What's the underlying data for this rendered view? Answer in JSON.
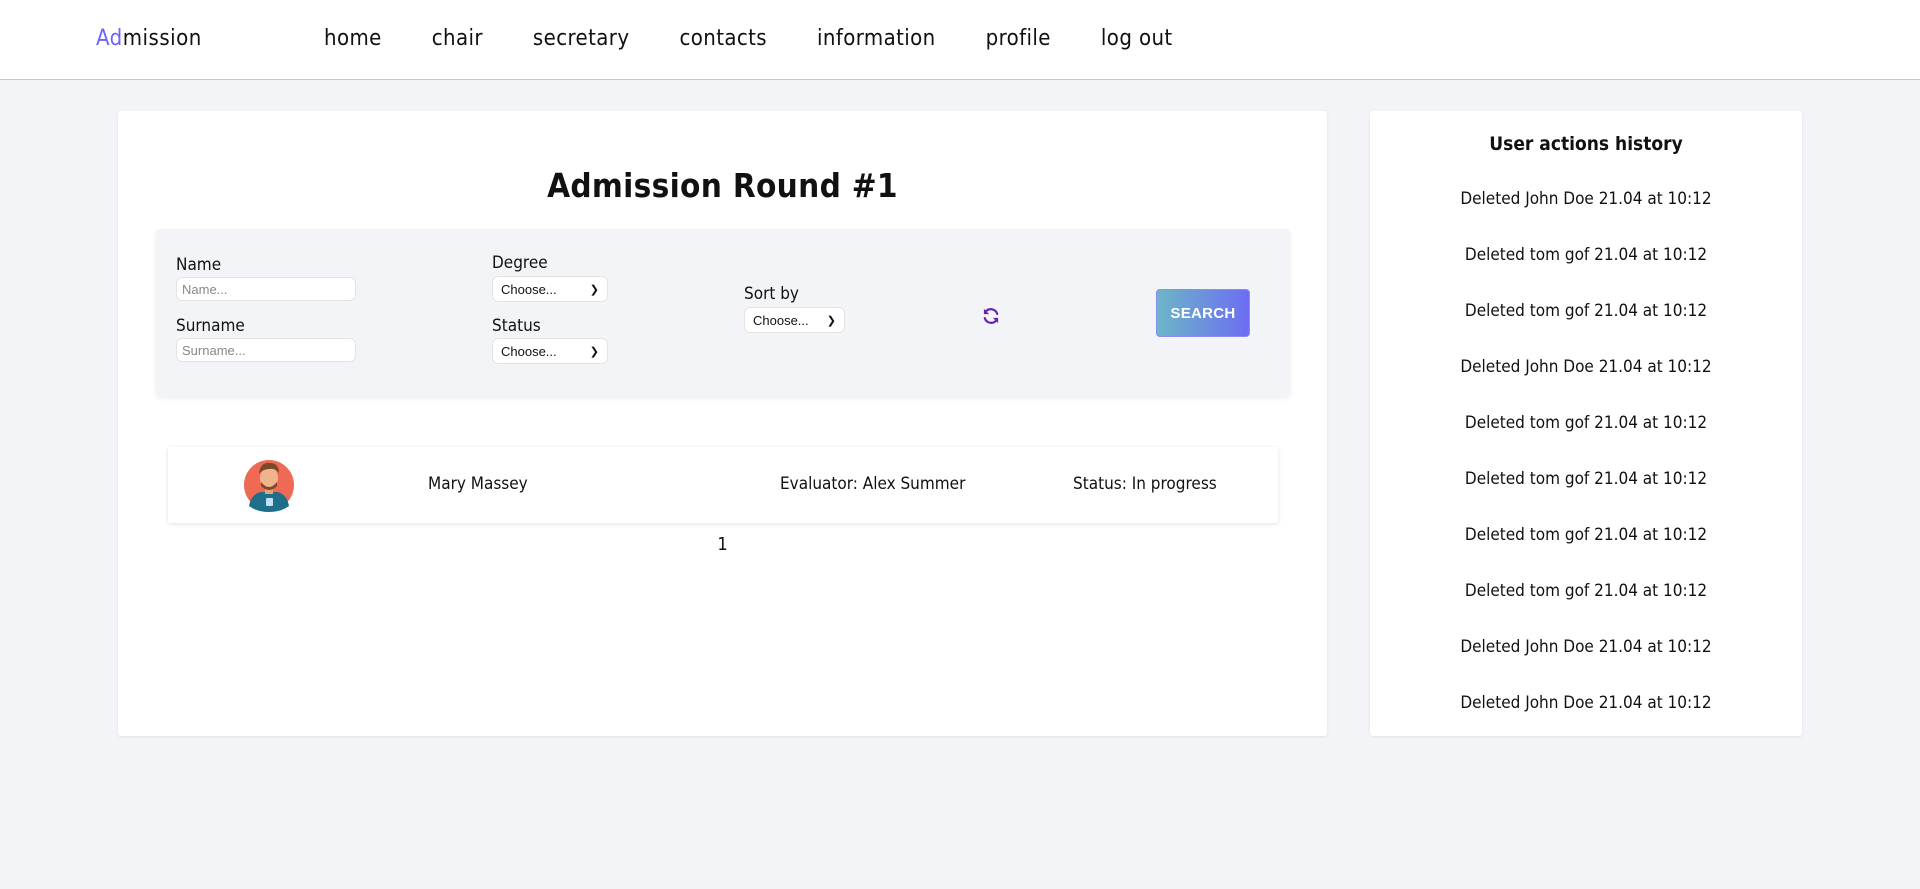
{
  "navbar": {
    "logo_accent": "Ad",
    "logo_rest": "mission",
    "links": [
      "home",
      "chair",
      "secretary",
      "contacts",
      "information",
      "profile",
      "log out"
    ]
  },
  "main": {
    "title": "Admission Round #1",
    "filters": {
      "name_label": "Name",
      "name_placeholder": "Name...",
      "surname_label": "Surname",
      "surname_placeholder": "Surname...",
      "degree_label": "Degree",
      "degree_value": "Choose...",
      "status_label": "Status",
      "status_value": "Choose...",
      "sort_label": "Sort by",
      "sort_value": "Choose...",
      "search_label": "SEARCH"
    },
    "results": [
      {
        "name": "Mary Massey",
        "evaluator": "Evaluator: Alex Summer",
        "status": "Status: In progress"
      }
    ],
    "pagination": [
      "1"
    ]
  },
  "history": {
    "title": "User actions history",
    "items": [
      "Deleted John Doe 21.04 at 10:12",
      "Deleted tom gof 21.04 at 10:12",
      "Deleted tom gof 21.04 at 10:12",
      "Deleted John Doe 21.04 at 10:12",
      "Deleted tom gof 21.04 at 10:12",
      "Deleted tom gof 21.04 at 10:12",
      "Deleted tom gof 21.04 at 10:12",
      "Deleted tom gof 21.04 at 10:12",
      "Deleted John Doe 21.04 at 10:12",
      "Deleted John Doe 21.04 at 10:12"
    ]
  },
  "colors": {
    "accent": "#6c63ff",
    "button_gradient_start": "#6cb6c7",
    "button_gradient_end": "#6c6df2",
    "page_background": "#f3f4f8"
  },
  "icons": {
    "refresh": "refresh-icon",
    "avatar": "avatar-icon"
  }
}
